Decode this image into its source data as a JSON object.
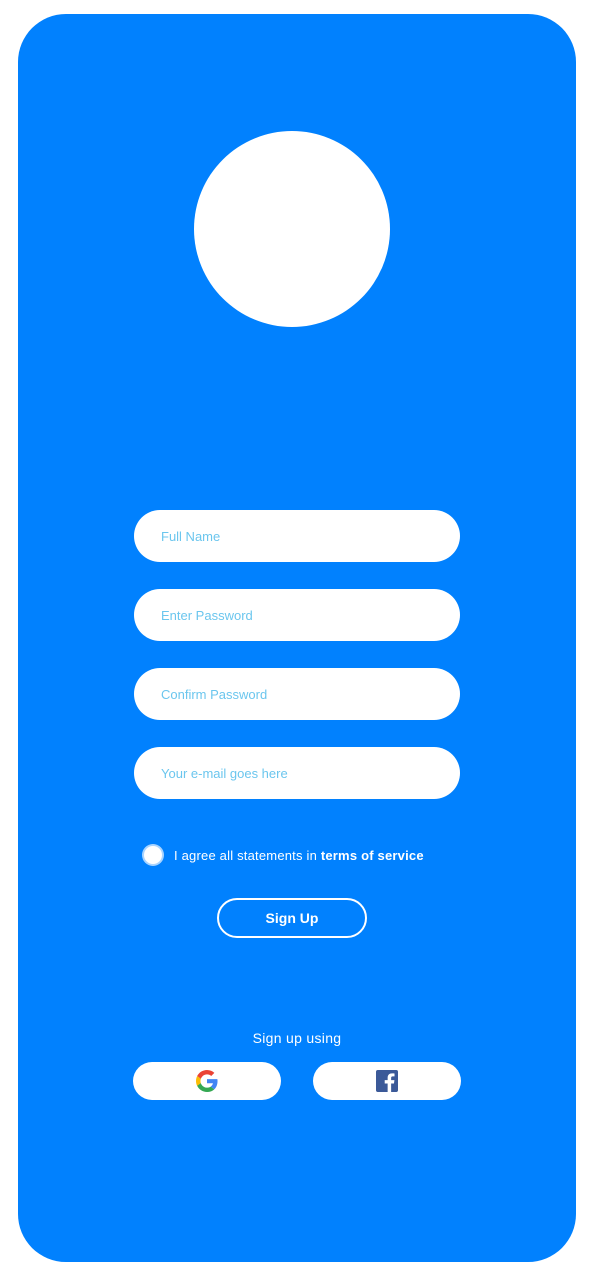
{
  "form": {
    "full_name_placeholder": "Full Name",
    "password_placeholder": "Enter Password",
    "confirm_password_placeholder": "Confirm Password",
    "email_placeholder": "Your e-mail goes here"
  },
  "agreement": {
    "text": "I agree all statements in ",
    "link": "terms of service"
  },
  "signup_button": "Sign Up",
  "social": {
    "heading": "Sign up using",
    "providers": [
      {
        "name": "Google",
        "icon": "google-icon"
      },
      {
        "name": "Facebook",
        "icon": "facebook-icon"
      }
    ]
  },
  "colors": {
    "background": "#0181fe",
    "placeholder": "#6bc6ee",
    "facebook": "#3b5998"
  }
}
